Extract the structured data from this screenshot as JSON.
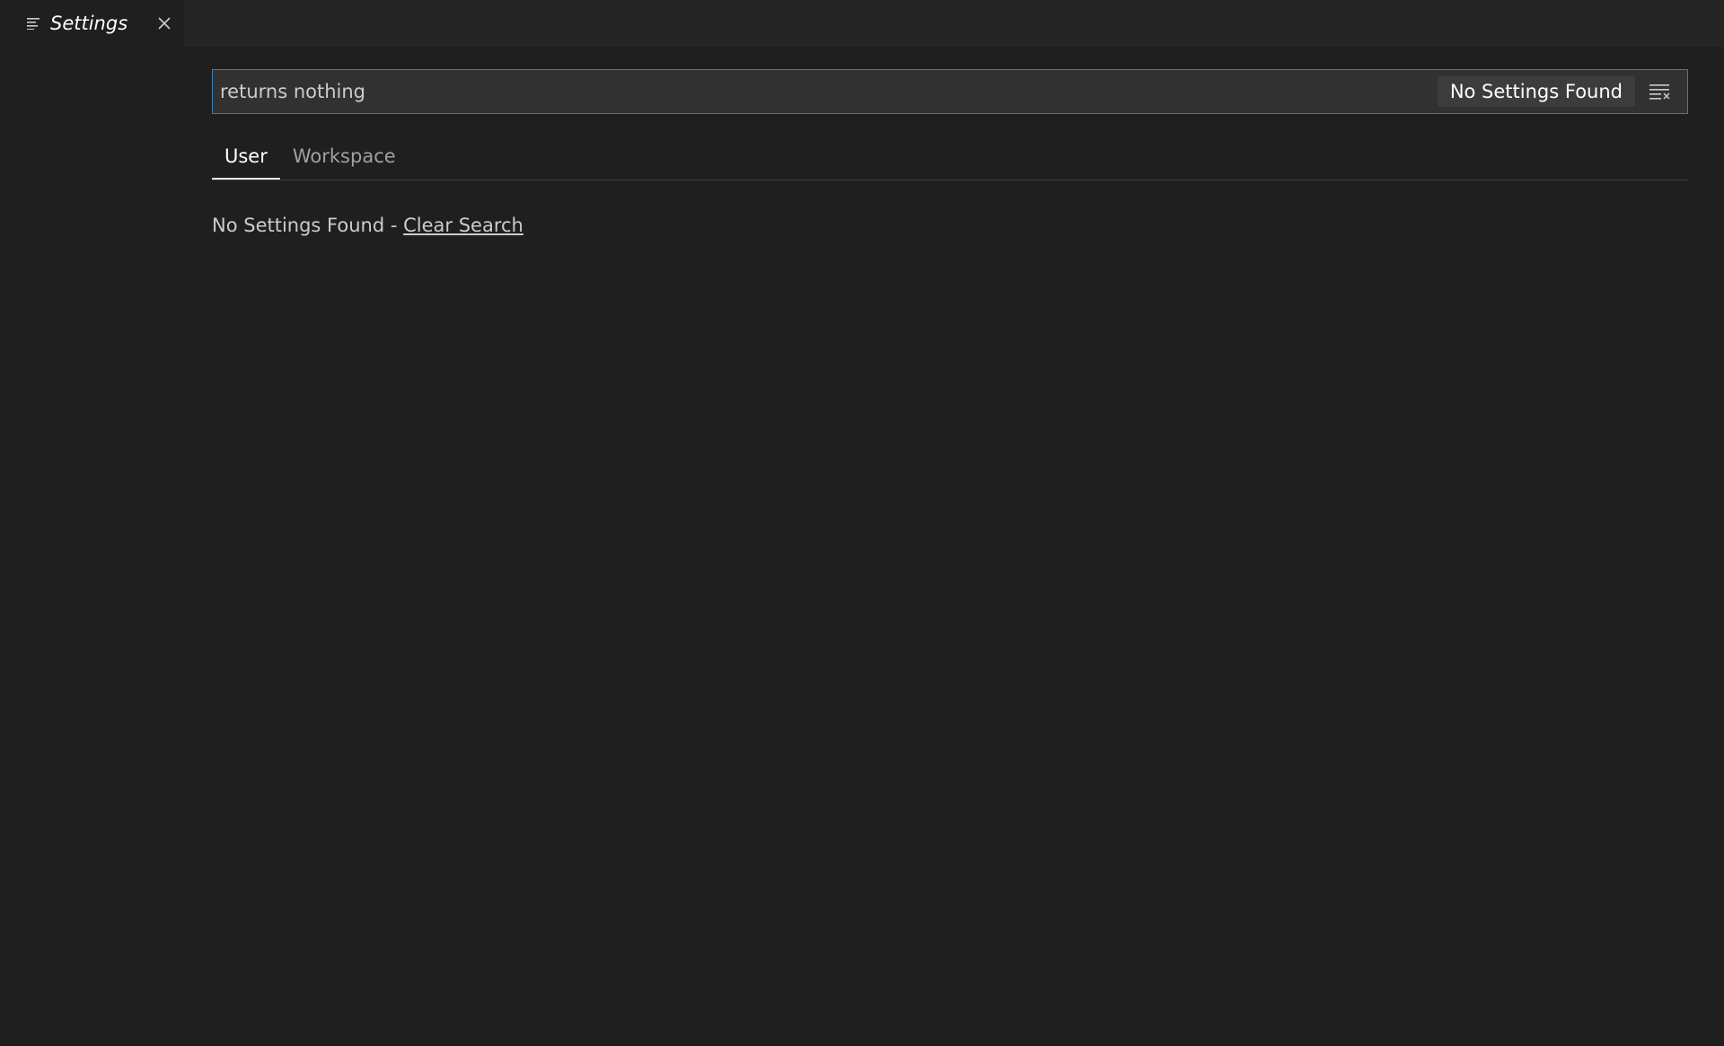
{
  "editor": {
    "tab_title": "Settings",
    "tab_icon": "settings-list-icon",
    "close_icon": "close-icon"
  },
  "search": {
    "value": "returns nothing",
    "result_count": "No Settings Found",
    "clear_icon": "clear-filter-icon",
    "border_color": "#3b7cb8"
  },
  "scope_tabs": [
    {
      "label": "User",
      "active": true
    },
    {
      "label": "Workspace",
      "active": false
    }
  ],
  "results": {
    "message": "No Settings Found - ",
    "clear_link": "Clear Search"
  }
}
